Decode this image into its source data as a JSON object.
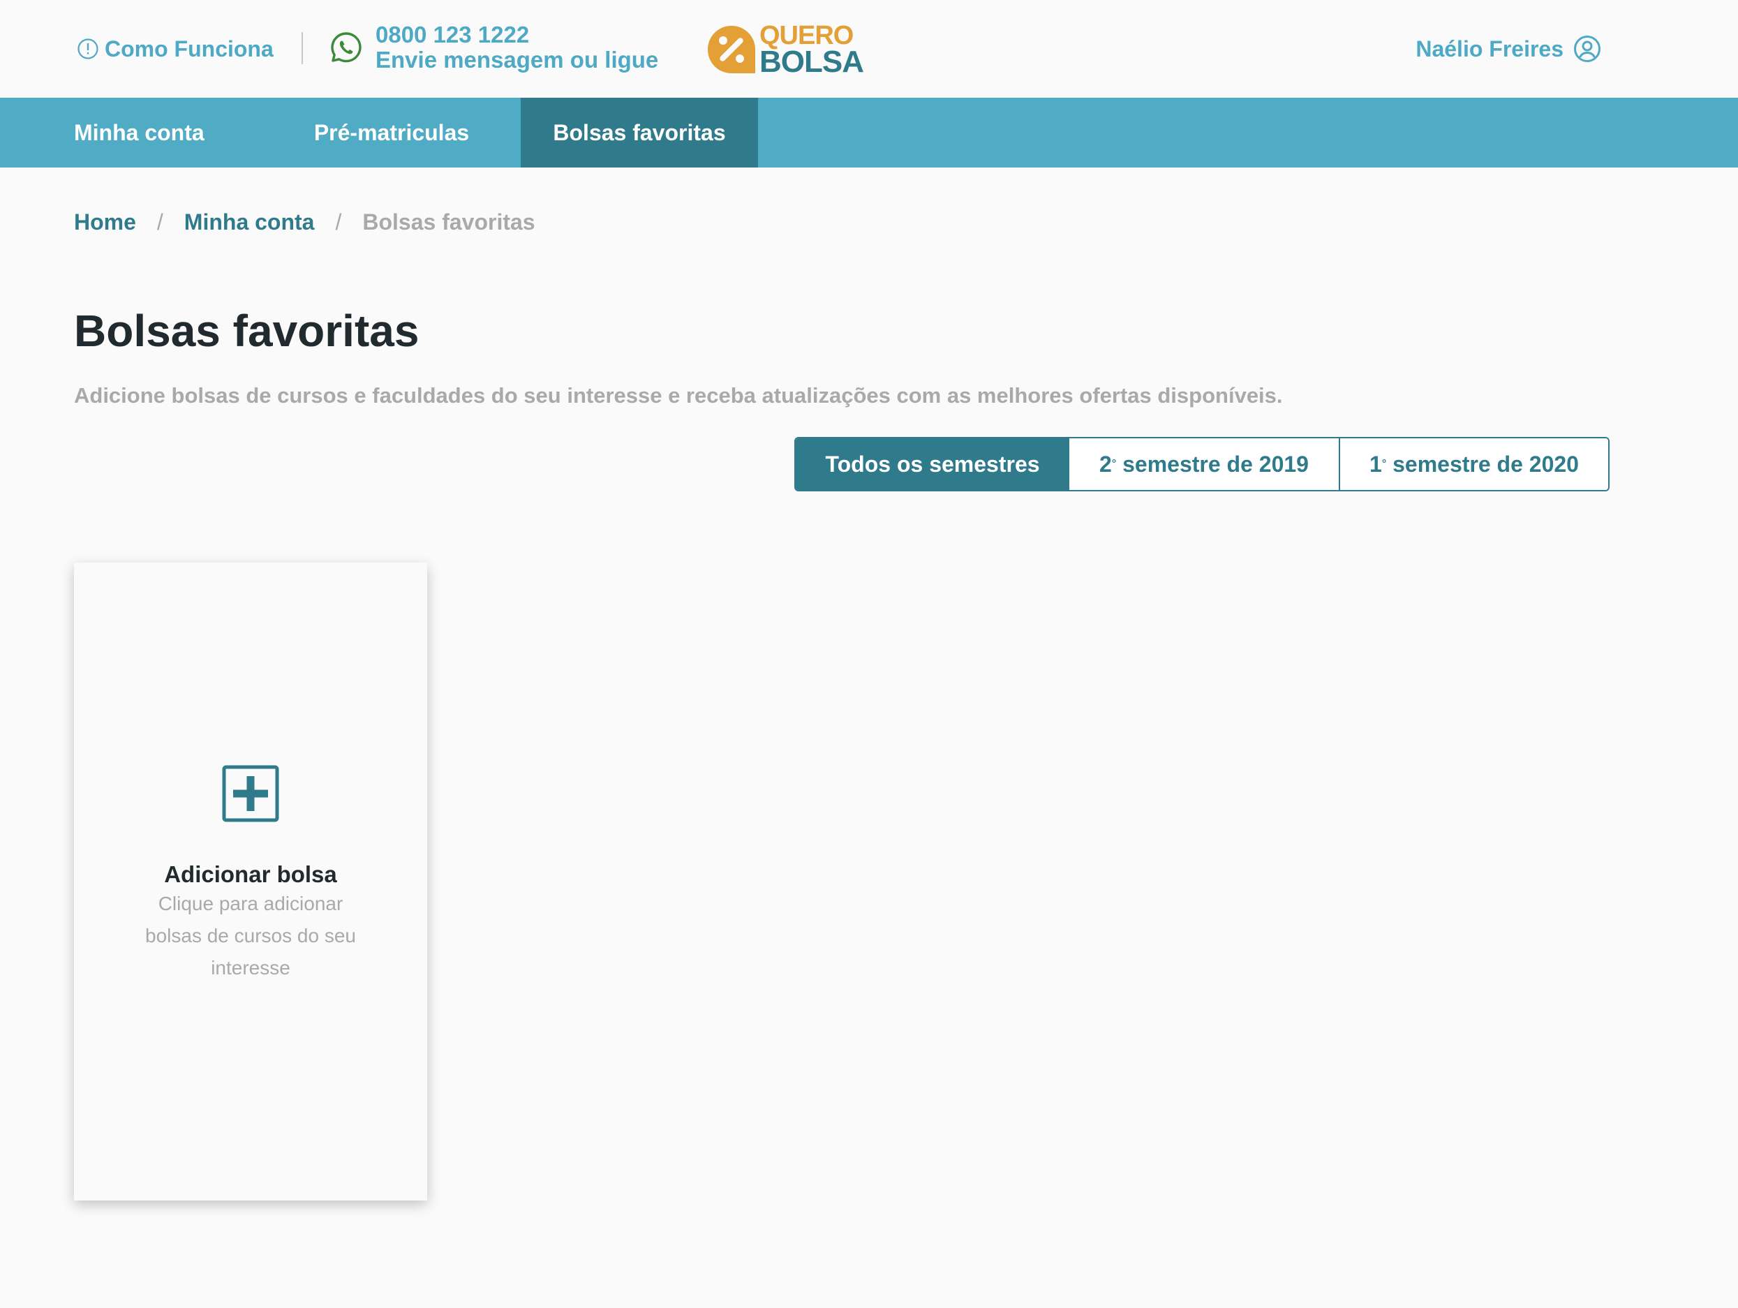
{
  "header": {
    "how_it_works": "Como Funciona",
    "phone": "0800 123 1222",
    "contact_text": "Envie mensagem ou ligue",
    "logo_top": "QUERO",
    "logo_bottom": "BOLSA",
    "user_name": "Naélio Freires"
  },
  "nav": {
    "tabs": [
      {
        "label": "Minha conta",
        "active": false
      },
      {
        "label": "Pré-matriculas",
        "active": false
      },
      {
        "label": "Bolsas favoritas",
        "active": true
      }
    ]
  },
  "breadcrumb": {
    "items": [
      "Home",
      "Minha conta",
      "Bolsas favoritas"
    ],
    "separator": "/"
  },
  "page": {
    "title": "Bolsas favoritas",
    "subtitle": "Adicione bolsas de cursos e faculdades do seu interesse e receba atualizações com as melhores ofertas disponíveis."
  },
  "filters": {
    "options": [
      {
        "label": "Todos os semestres",
        "active": true
      },
      {
        "number": "2",
        "ordinal": "°",
        "label": " semestre de 2019",
        "active": false
      },
      {
        "number": "1",
        "ordinal": "°",
        "label": " semestre de 2020",
        "active": false
      }
    ]
  },
  "add_card": {
    "title": "Adicionar bolsa",
    "description": "Clique para adicionar bolsas de cursos do seu interesse"
  },
  "colors": {
    "accent": "#4ea9c4",
    "nav_bg": "#50abc4",
    "dark_teal": "#2f7b8c",
    "logo_orange": "#e2a036",
    "muted": "#a9a9a9",
    "title": "#212b2f",
    "whatsapp": "#3a8a3a"
  },
  "icons": {
    "how_it_works": "info-circle-icon",
    "contact": "whatsapp-icon",
    "user": "user-circle-icon",
    "add": "plus-square-icon"
  }
}
